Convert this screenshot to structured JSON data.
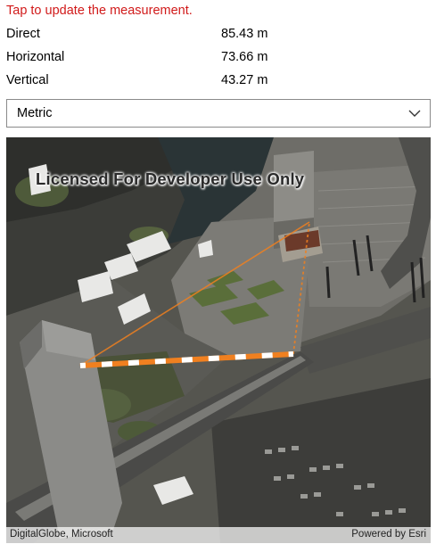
{
  "instructions": "Tap to update the measurement.",
  "measurements": [
    {
      "label": "Direct",
      "value": "85.43 m"
    },
    {
      "label": "Horizontal",
      "value": "73.66 m"
    },
    {
      "label": "Vertical",
      "value": "43.27 m"
    }
  ],
  "unit_select": {
    "selected": "Metric"
  },
  "map": {
    "watermark": "Licensed For Developer Use Only",
    "attribution": "DigitalGlobe, Microsoft",
    "powered_by": "Powered by Esri"
  },
  "colors": {
    "instructions": "#d11a1a",
    "measure_line": "#f08020",
    "measure_dash": "#ffffff"
  }
}
